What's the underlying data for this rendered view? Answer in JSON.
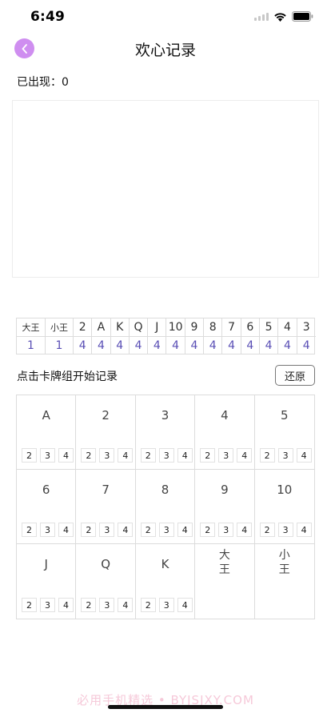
{
  "status": {
    "time": "6:49"
  },
  "nav": {
    "title": "欢心记录"
  },
  "appeared": "已出现：0",
  "counts": {
    "headers": [
      "大王",
      "小王",
      "2",
      "A",
      "K",
      "Q",
      "J",
      "10",
      "9",
      "8",
      "7",
      "6",
      "5",
      "4",
      "3"
    ],
    "values": [
      "1",
      "1",
      "4",
      "4",
      "4",
      "4",
      "4",
      "4",
      "4",
      "4",
      "4",
      "4",
      "4",
      "4",
      "4"
    ]
  },
  "hint": "点击卡牌组开始记录",
  "restore_label": "还原",
  "cards": [
    {
      "label": "A",
      "counters": [
        "2",
        "3",
        "4"
      ]
    },
    {
      "label": "2",
      "counters": [
        "2",
        "3",
        "4"
      ]
    },
    {
      "label": "3",
      "counters": [
        "2",
        "3",
        "4"
      ]
    },
    {
      "label": "4",
      "counters": [
        "2",
        "3",
        "4"
      ]
    },
    {
      "label": "5",
      "counters": [
        "2",
        "3",
        "4"
      ]
    },
    {
      "label": "6",
      "counters": [
        "2",
        "3",
        "4"
      ]
    },
    {
      "label": "7",
      "counters": [
        "2",
        "3",
        "4"
      ]
    },
    {
      "label": "8",
      "counters": [
        "2",
        "3",
        "4"
      ]
    },
    {
      "label": "9",
      "counters": [
        "2",
        "3",
        "4"
      ]
    },
    {
      "label": "10",
      "counters": [
        "2",
        "3",
        "4"
      ]
    },
    {
      "label": "J",
      "counters": [
        "2",
        "3",
        "4"
      ]
    },
    {
      "label": "Q",
      "counters": [
        "2",
        "3",
        "4"
      ]
    },
    {
      "label": "K",
      "counters": [
        "2",
        "3",
        "4"
      ]
    },
    {
      "label": "大王",
      "counters": []
    },
    {
      "label": "小王",
      "counters": []
    }
  ],
  "watermark": "必用手机精选 • BYJSJXY.COM",
  "colors": {
    "accent": "#cf8ef0",
    "count_value": "#5a4fb5"
  },
  "icons": {
    "back": "chevron-left-icon",
    "wifi": "wifi-icon",
    "battery": "battery-icon",
    "signal": "signal-icon"
  }
}
